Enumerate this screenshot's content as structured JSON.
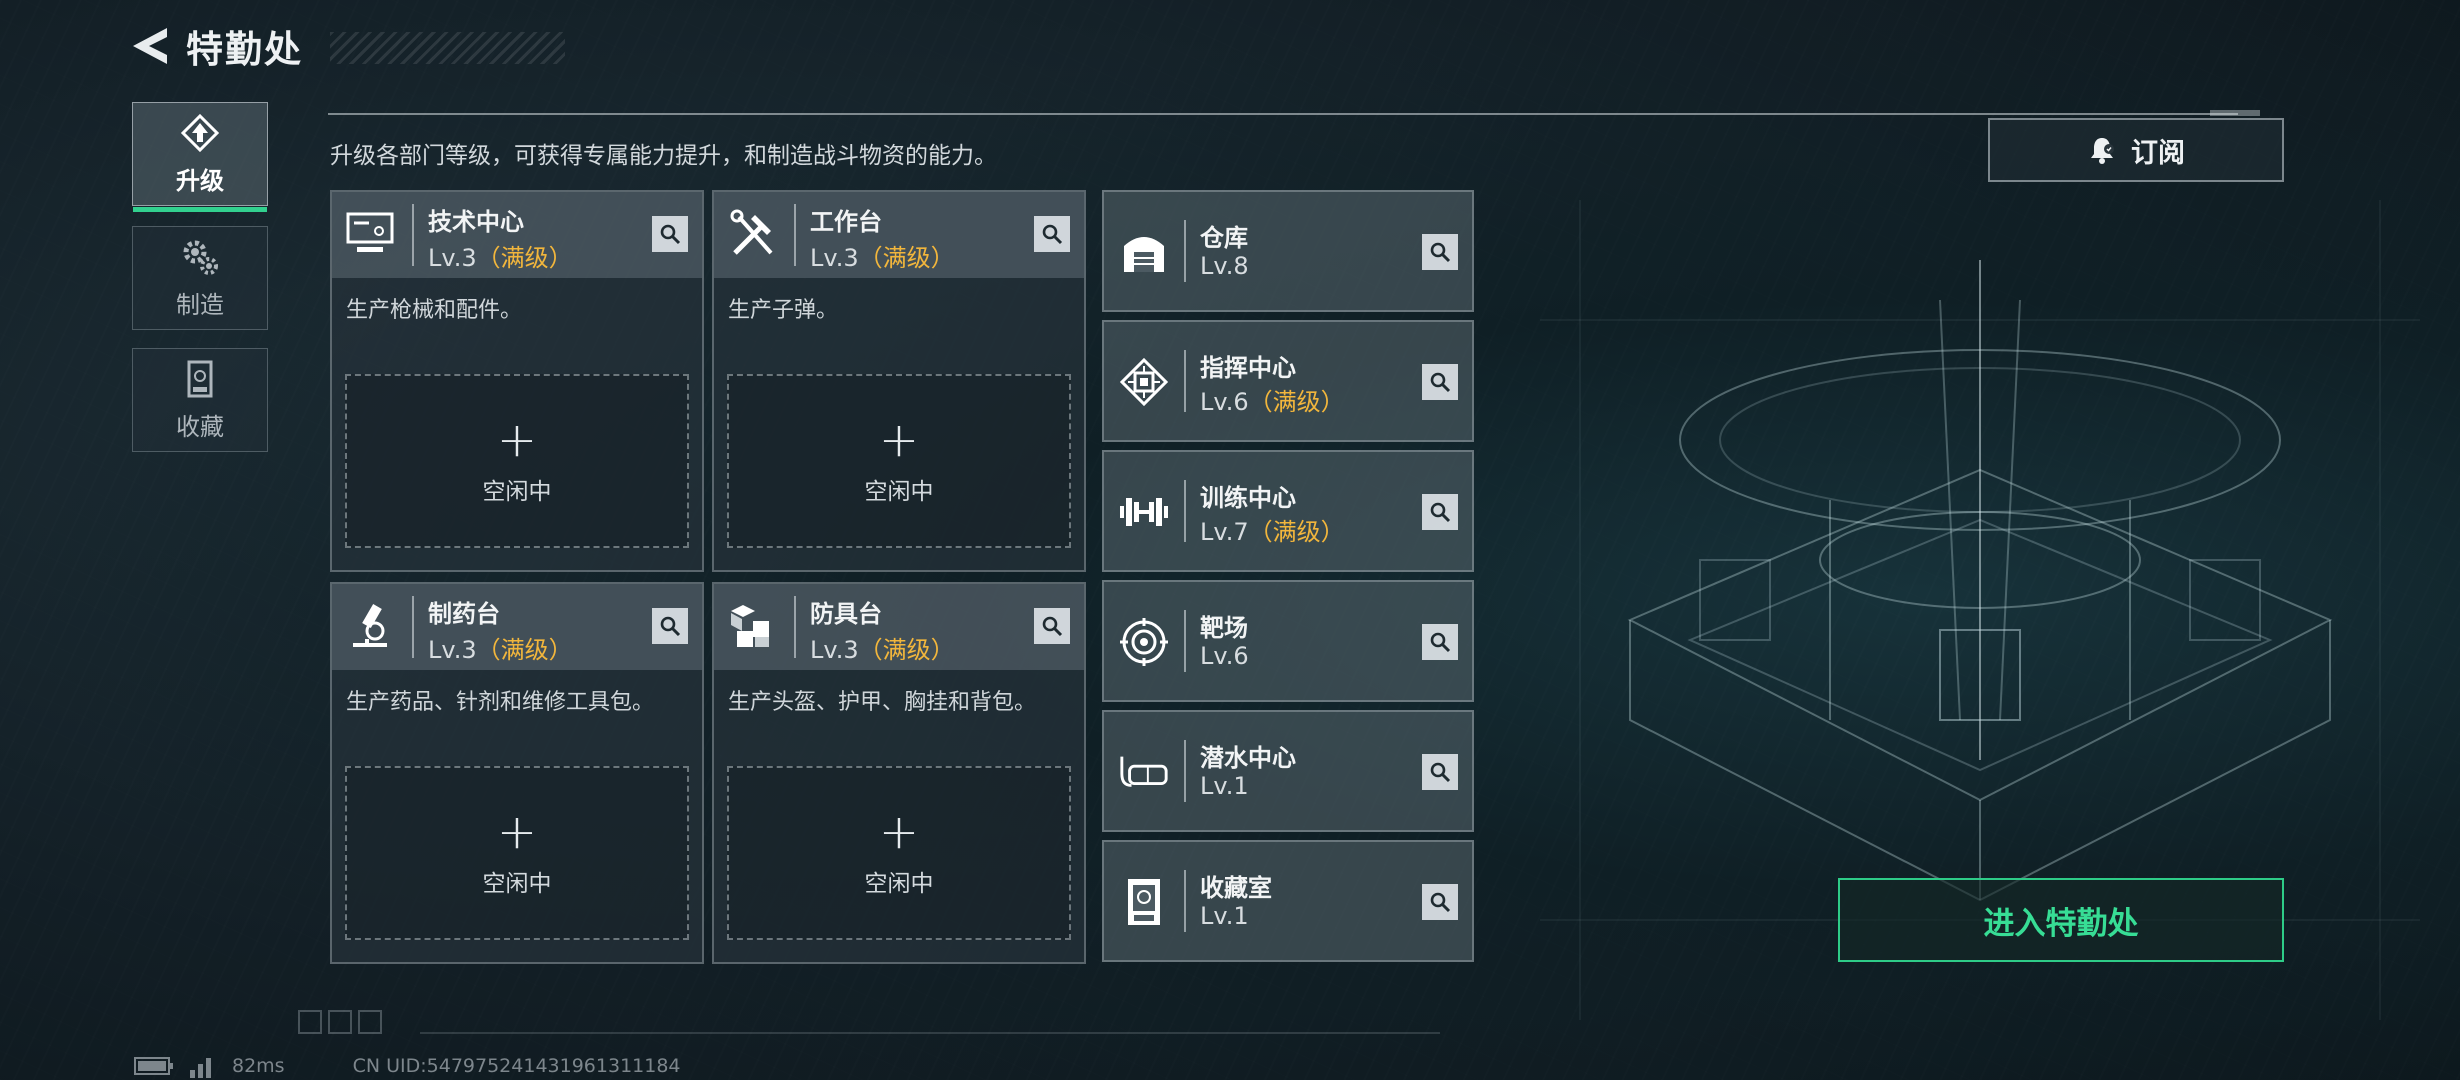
{
  "header": {
    "title": "特勤处"
  },
  "sidebar": {
    "tabs": [
      {
        "label": "升级",
        "active": true
      },
      {
        "label": "制造",
        "active": false
      },
      {
        "label": "收藏",
        "active": false
      }
    ]
  },
  "description": "升级各部门等级，可获得专属能力提升，和制造战斗物资的能力。",
  "subscribe_label": "订阅",
  "workstations": [
    {
      "name": "技术中心",
      "level": "Lv.3",
      "max_tag": "（满级）",
      "info": "生产枪械和配件。",
      "slot_plus": "+",
      "slot_status": "空闲中"
    },
    {
      "name": "工作台",
      "level": "Lv.3",
      "max_tag": "（满级）",
      "info": "生产子弹。",
      "slot_plus": "+",
      "slot_status": "空闲中"
    },
    {
      "name": "制药台",
      "level": "Lv.3",
      "max_tag": "（满级）",
      "info": "生产药品、针剂和维修工具包。",
      "slot_plus": "+",
      "slot_status": "空闲中"
    },
    {
      "name": "防具台",
      "level": "Lv.3",
      "max_tag": "（满级）",
      "info": "生产头盔、护甲、胸挂和背包。",
      "slot_plus": "+",
      "slot_status": "空闲中"
    }
  ],
  "facilities": [
    {
      "name": "仓库",
      "level": "Lv.8",
      "max_tag": "",
      "icon": "warehouse-icon"
    },
    {
      "name": "指挥中心",
      "level": "Lv.6",
      "max_tag": "（满级）",
      "icon": "chip-icon"
    },
    {
      "name": "训练中心",
      "level": "Lv.7",
      "max_tag": "（满级）",
      "icon": "dumbbell-icon"
    },
    {
      "name": "靶场",
      "level": "Lv.6",
      "max_tag": "",
      "icon": "target-icon"
    },
    {
      "name": "潜水中心",
      "level": "Lv.1",
      "max_tag": "",
      "icon": "diving-mask-icon"
    },
    {
      "name": "收藏室",
      "level": "Lv.1",
      "max_tag": "",
      "icon": "display-case-icon"
    }
  ],
  "enter_label": "进入特勤处",
  "footer": {
    "ping": "82ms",
    "uid": "CN UID:547975241431961311184"
  },
  "colors": {
    "accent_green": "#32d18f",
    "max_level": "#f2b63c"
  }
}
